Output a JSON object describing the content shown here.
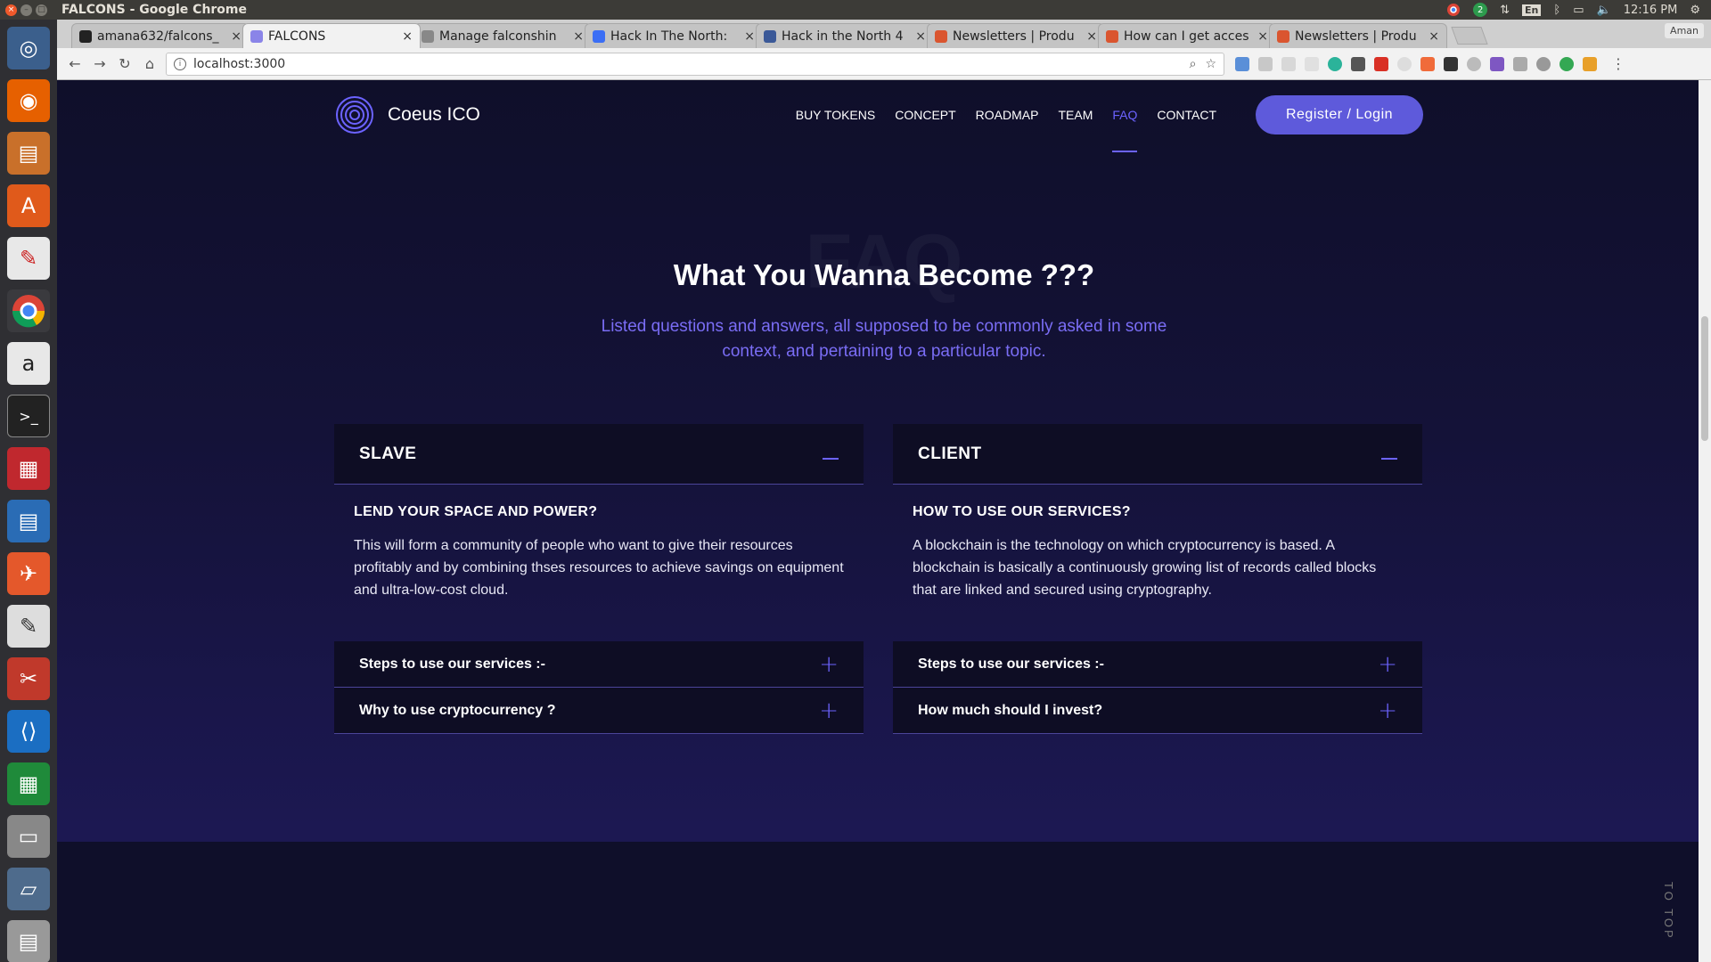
{
  "system": {
    "window_title": "FALCONS - Google Chrome",
    "tray_badge": "2",
    "lang": "En",
    "clock": "12:16 PM"
  },
  "browser": {
    "tabs": [
      {
        "title": "amana632/falcons_",
        "favicon_color": "#222222"
      },
      {
        "title": "FALCONS",
        "favicon_color": "#8a84e8"
      },
      {
        "title": "Manage falconshin",
        "favicon_color": "#888888"
      },
      {
        "title": "Hack In The North:",
        "favicon_color": "#3b6ef5"
      },
      {
        "title": "Hack in the North 4",
        "favicon_color": "#3b5998"
      },
      {
        "title": "Newsletters | Produ",
        "favicon_color": "#da552f"
      },
      {
        "title": "How can I get acces",
        "favicon_color": "#da552f"
      },
      {
        "title": "Newsletters | Produ",
        "favicon_color": "#da552f"
      }
    ],
    "user": "Aman",
    "url": "localhost:3000"
  },
  "site": {
    "logo_text": "Coeus ICO",
    "nav": [
      "BUY TOKENS",
      "CONCEPT",
      "ROADMAP",
      "TEAM",
      "FAQ",
      "CONTACT"
    ],
    "active_nav": "FAQ",
    "register_label": "Register / Login"
  },
  "faq": {
    "watermark": "FAQ",
    "title": "What You Wanna Become ???",
    "subtitle": "Listed questions and answers, all supposed to be commonly asked in some context, and pertaining to a particular topic.",
    "left": {
      "heading": "SLAVE",
      "question": "LEND YOUR SPACE AND POWER?",
      "answer": "This will form a community of people who want to give their resources profitably and by combining thses resources to achieve savings on equipment and ultra-low-cost cloud.",
      "rows": [
        "Steps to use our services :-",
        "Why to use cryptocurrency ?"
      ]
    },
    "right": {
      "heading": "CLIENT",
      "question": "HOW TO USE OUR SERVICES?",
      "answer": "A blockchain is the technology on which cryptocurrency is based. A blockchain is basically a continuously growing list of records called blocks that are linked and secured using cryptography.",
      "rows": [
        "Steps to use our services :-",
        "How much should I invest?"
      ]
    }
  },
  "to_top": "TO TOP",
  "colors": {
    "accent": "#6c63ff",
    "button": "#5e5adb",
    "subtitle": "#7a6df5",
    "background": "#0f0f2a"
  }
}
